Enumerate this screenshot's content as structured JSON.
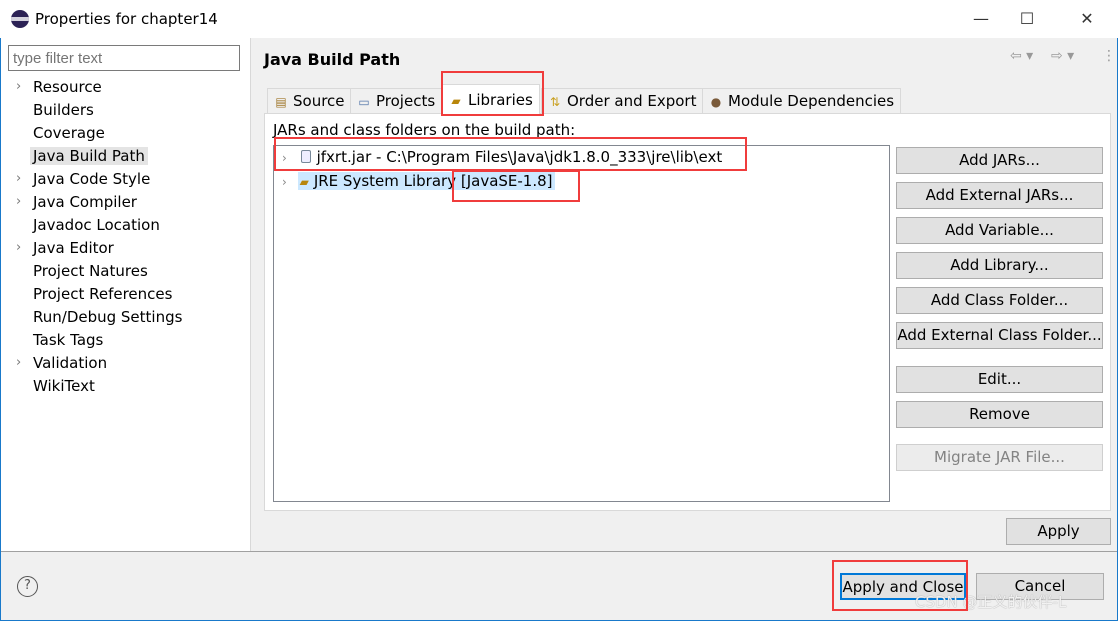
{
  "window": {
    "title": "Properties for chapter14",
    "controls": [
      "—",
      "☐",
      "✕"
    ]
  },
  "filter": {
    "placeholder": "type filter text"
  },
  "tree": [
    {
      "label": "Resource",
      "expandable": true
    },
    {
      "label": "Builders",
      "expandable": false
    },
    {
      "label": "Coverage",
      "expandable": false
    },
    {
      "label": "Java Build Path",
      "expandable": false,
      "selected": true
    },
    {
      "label": "Java Code Style",
      "expandable": true
    },
    {
      "label": "Java Compiler",
      "expandable": true
    },
    {
      "label": "Javadoc Location",
      "expandable": false
    },
    {
      "label": "Java Editor",
      "expandable": true
    },
    {
      "label": "Project Natures",
      "expandable": false
    },
    {
      "label": "Project References",
      "expandable": false
    },
    {
      "label": "Run/Debug Settings",
      "expandable": false
    },
    {
      "label": "Task Tags",
      "expandable": false
    },
    {
      "label": "Validation",
      "expandable": true
    },
    {
      "label": "WikiText",
      "expandable": false
    }
  ],
  "page": {
    "title": "Java Build Path"
  },
  "tabs": [
    {
      "label": "Source",
      "icon": "source-folder-icon"
    },
    {
      "label": "Projects",
      "icon": "folder-icon"
    },
    {
      "label": "Libraries",
      "icon": "library-icon",
      "active": true
    },
    {
      "label": "Order and Export",
      "icon": "order-icon"
    },
    {
      "label": "Module Dependencies",
      "icon": "module-icon"
    }
  ],
  "libraries": {
    "caption": "JARs and class folders on the build path:",
    "entries": [
      {
        "name": "jfxrt.jar - C:\\Program Files\\Java\\jdk1.8.0_333\\jre\\lib\\ext",
        "icon": "jar-icon"
      },
      {
        "name": "JRE System Library",
        "suffix": "[JavaSE-1.8]",
        "icon": "library-icon",
        "selected": true
      }
    ],
    "buttons": [
      "Add JARs...",
      "Add External JARs...",
      "Add Variable...",
      "Add Library...",
      "Add Class Folder...",
      "Add External Class Folder...",
      "Edit...",
      "Remove",
      "Migrate JAR File..."
    ]
  },
  "footer": {
    "apply": "Apply",
    "apply_close": "Apply and Close",
    "cancel": "Cancel",
    "help": "?",
    "watermark": "CSDN @正义的伙伴-L"
  },
  "colors": {
    "highlight": "#f03c3c",
    "accent": "#0078d7",
    "selection": "#cce8ff"
  }
}
